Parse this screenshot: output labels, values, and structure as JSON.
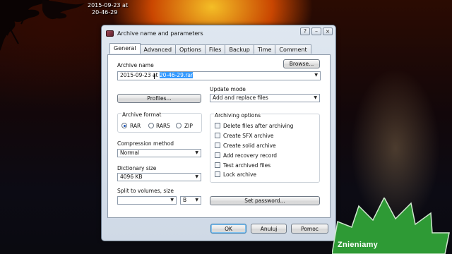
{
  "desktop": {
    "clock_line1": "2015-09-23 at",
    "clock_line2": "20-46-29"
  },
  "window": {
    "title": "Archive name and parameters",
    "controls": [
      "?",
      "–",
      "×"
    ]
  },
  "tabs": [
    "General",
    "Advanced",
    "Options",
    "Files",
    "Backup",
    "Time",
    "Comment"
  ],
  "general": {
    "archive_name_label": "Archive name",
    "browse_label": "Browse...",
    "archive_name_prefix": "2015-09-23 at ",
    "archive_name_selected": "20-46-29.rar",
    "profiles_label": "Profiles...",
    "update_mode_label": "Update mode",
    "update_mode_value": "Add and replace files",
    "archive_format_label": "Archive format",
    "formats": [
      "RAR",
      "RAR5",
      "ZIP"
    ],
    "selected_format": "RAR",
    "compression_label": "Compression method",
    "compression_value": "Normal",
    "dictionary_label": "Dictionary size",
    "dictionary_value": "4096 KB",
    "split_label": "Split to volumes, size",
    "split_value": "",
    "split_unit": "B",
    "archiving_options_label": "Archiving options",
    "options": [
      "Delete files after archiving",
      "Create SFX archive",
      "Create solid archive",
      "Add recovery record",
      "Test archived files",
      "Lock archive"
    ],
    "set_password_label": "Set password..."
  },
  "footer": {
    "ok": "OK",
    "cancel": "Anuluj",
    "help": "Pomoc"
  },
  "badge": {
    "text": "Znieniamy"
  }
}
